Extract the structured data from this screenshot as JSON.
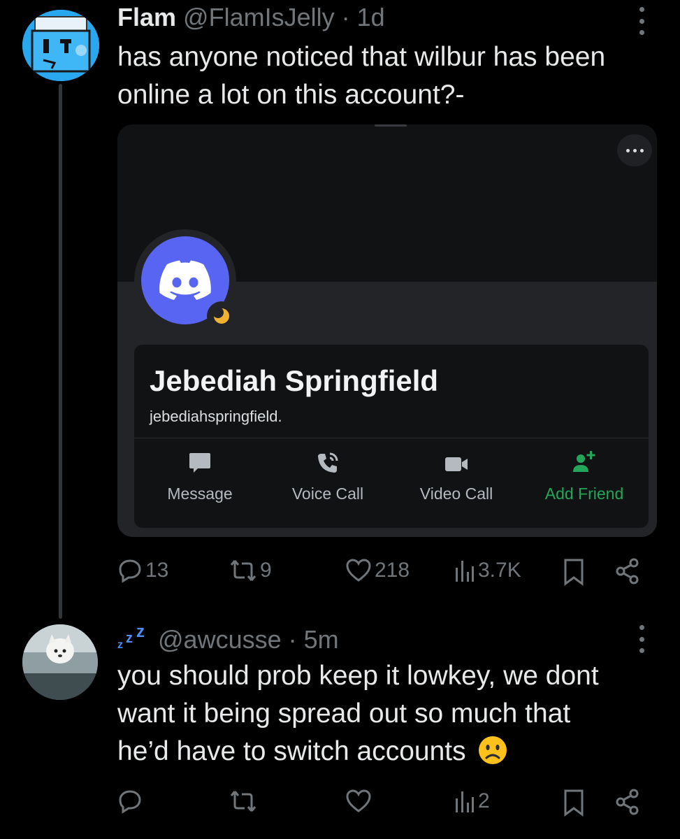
{
  "tweet": {
    "display_name": "Flam",
    "handle": "@FlamIsJelly",
    "separator": "·",
    "time": "1d",
    "text_line1": "has anyone noticed that wilbur has been",
    "text_line2": "online a lot on this account?-",
    "stats": {
      "replies": "13",
      "reposts": "9",
      "likes": "218",
      "views": "3.7K"
    }
  },
  "discord_card": {
    "display_name": "Jebediah Springfield",
    "username": "jebediahspringfield.",
    "actions": [
      {
        "label": "Message",
        "icon": "message-icon"
      },
      {
        "label": "Voice Call",
        "icon": "phone-icon"
      },
      {
        "label": "Video Call",
        "icon": "video-camera-icon"
      },
      {
        "label": "Add Friend",
        "icon": "add-friend-icon"
      }
    ],
    "colors": {
      "blurple": "#5865f2",
      "add_friend": "#23a55a",
      "idle": "#f0b232"
    }
  },
  "reply": {
    "prefix_emoji": "zzz",
    "handle": "@awcusse",
    "separator": "·",
    "time": "5m",
    "text_line1": "you should prob keep it lowkey, we dont",
    "text_line2": "want it being spread out so much that",
    "text_line3": "he’d have to switch accounts",
    "trailing_emoji": "frowning-face",
    "stats": {
      "views": "2"
    }
  },
  "colors": {
    "background": "#000000",
    "text": "#e7e9ea",
    "muted": "#71767b"
  }
}
